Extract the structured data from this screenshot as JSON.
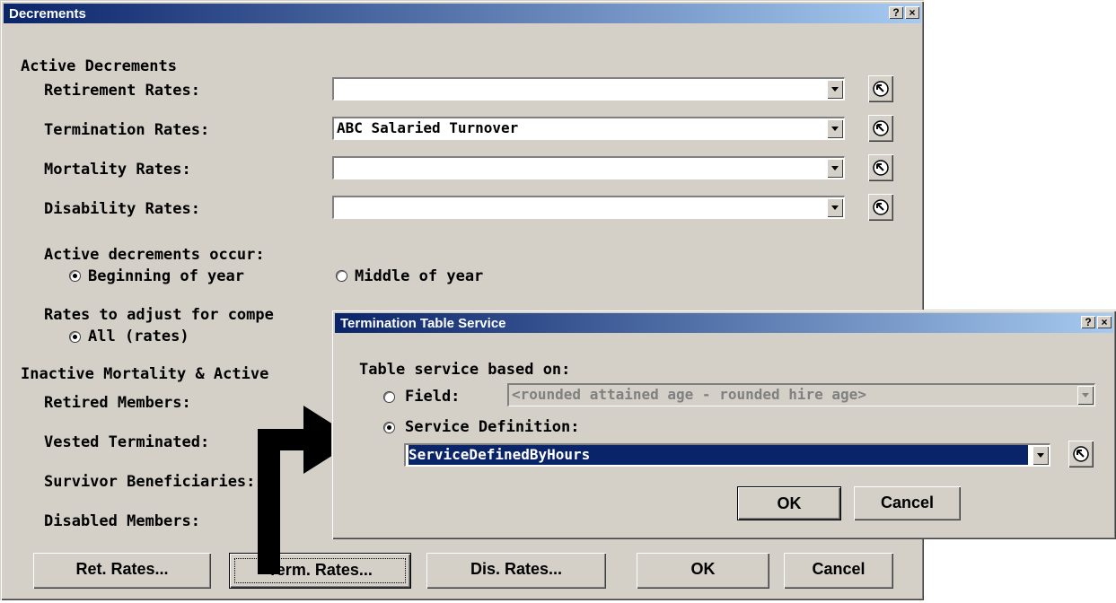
{
  "main_dialog": {
    "title": "Decrements",
    "help_btn": "?",
    "close_btn": "×",
    "section_active": "Active Decrements",
    "retirement_label": "Retirement Rates:",
    "retirement_value": "",
    "termination_label": "Termination Rates:",
    "termination_value": "ABC Salaried Turnover",
    "mortality_label": "Mortality Rates:",
    "mortality_value": "",
    "disability_label": "Disability Rates:",
    "disability_value": "",
    "occur_label": "Active decrements occur:",
    "occur_options": [
      "Beginning of year",
      "Middle of year"
    ],
    "occur_selected": "Beginning of year",
    "adjust_label": "Rates to adjust for compe",
    "adjust_option": "All (rates)",
    "section_inactive": "Inactive Mortality & Active",
    "retired_label": "Retired Members:",
    "vested_label": "Vested Terminated:",
    "survivor_label": "Survivor Beneficiaries:",
    "disabled_label": "Disabled Members:",
    "buttons": {
      "ret": "Ret. Rates...",
      "term": "Term. Rates...",
      "dis": "Dis. Rates...",
      "ok": "OK",
      "cancel": "Cancel"
    }
  },
  "sub_dialog": {
    "title": "Termination Table Service",
    "help_btn": "?",
    "close_btn": "×",
    "based_on_label": "Table service based on:",
    "field_label": "Field:",
    "field_value": "<rounded attained age - rounded hire age>",
    "service_def_label": "Service Definition:",
    "service_def_value": "ServiceDefinedByHours",
    "selected": "Service Definition",
    "ok": "OK",
    "cancel": "Cancel"
  },
  "colors": {
    "title_start": "#0a246a",
    "title_end": "#a6caf0",
    "dialog_face": "#d4d0c8",
    "selection": "#0a246a",
    "arrow": "#000000"
  },
  "icons": [
    "help-icon",
    "close-icon",
    "dropdown-arrow-icon",
    "pick-arrow-icon",
    "callout-arrow-icon"
  ]
}
